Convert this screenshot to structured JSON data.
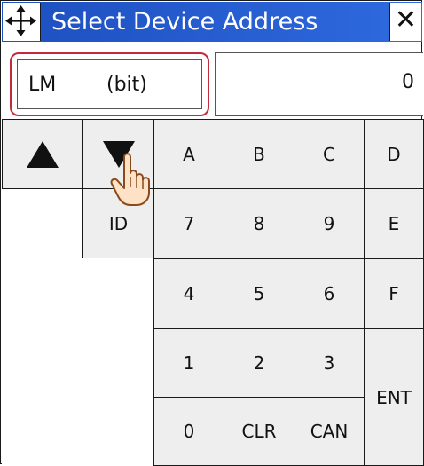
{
  "dialog": {
    "title": "Select Device Address",
    "move_icon": "move-arrows-icon",
    "close_label": "✕",
    "titlebar_color": "#1d4fbf",
    "highlight_color": "#c22b3a"
  },
  "device": {
    "name": "LM",
    "type": "(bit)"
  },
  "value": "0",
  "keys": {
    "up": "up-arrow-icon",
    "down": "down-arrow-icon",
    "id": "ID",
    "a": "A",
    "b": "B",
    "c": "C",
    "d": "D",
    "k7": "7",
    "k8": "8",
    "k9": "9",
    "e": "E",
    "k4": "4",
    "k5": "5",
    "k6": "6",
    "f": "F",
    "k1": "1",
    "k2": "2",
    "k3": "3",
    "k0": "0",
    "clr": "CLR",
    "can": "CAN",
    "ent": "ENT"
  },
  "cursor": "pointing-hand-icon"
}
